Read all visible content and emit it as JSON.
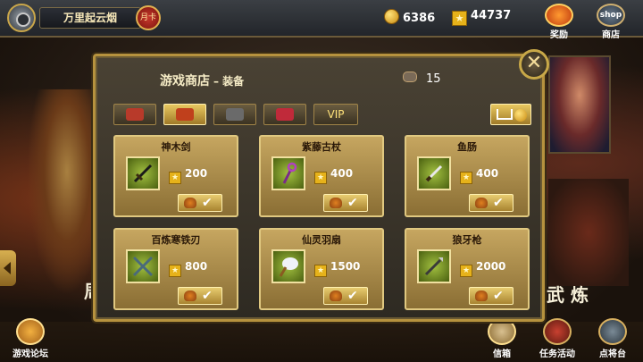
{
  "player": {
    "name": "万里起云烟",
    "rank_badge": "月卡"
  },
  "resources": {
    "gold": "6386",
    "stars": "44737"
  },
  "top_buttons": {
    "reward": "奖励",
    "shop_icon_text": "shop",
    "shop": "商店"
  },
  "background_text": {
    "left": "周",
    "right": "武 炼"
  },
  "panel": {
    "title": "游戏商店",
    "subtitle": "– 装备",
    "stock_count": "15",
    "close_label": "✕",
    "tabs": [
      {
        "icon": "treasure-chest-icon"
      },
      {
        "icon": "horse-icon",
        "active": true
      },
      {
        "icon": "crossed-swords-icon"
      },
      {
        "icon": "potion-icon"
      },
      {
        "icon": "vip-icon",
        "label": "VIP"
      }
    ],
    "items": [
      {
        "name": "神木剑",
        "price": "200",
        "icon": "sword-icon"
      },
      {
        "name": "紫藤古杖",
        "price": "400",
        "icon": "staff-icon"
      },
      {
        "name": "鱼肠",
        "price": "400",
        "icon": "dagger-icon"
      },
      {
        "name": "百炼寒铁刃",
        "price": "800",
        "icon": "twin-blades-icon"
      },
      {
        "name": "仙灵羽扇",
        "price": "1500",
        "icon": "feather-fan-icon"
      },
      {
        "name": "狼牙枪",
        "price": "2000",
        "icon": "spear-icon"
      }
    ]
  },
  "bottom_buttons": {
    "forum": "游戏论坛",
    "mail": "信箱",
    "tasks": "任务活动",
    "arena": "点将台"
  },
  "colors": {
    "gold": "#c9a64a",
    "card": "#c6a660",
    "accent": "#ffe27a"
  }
}
